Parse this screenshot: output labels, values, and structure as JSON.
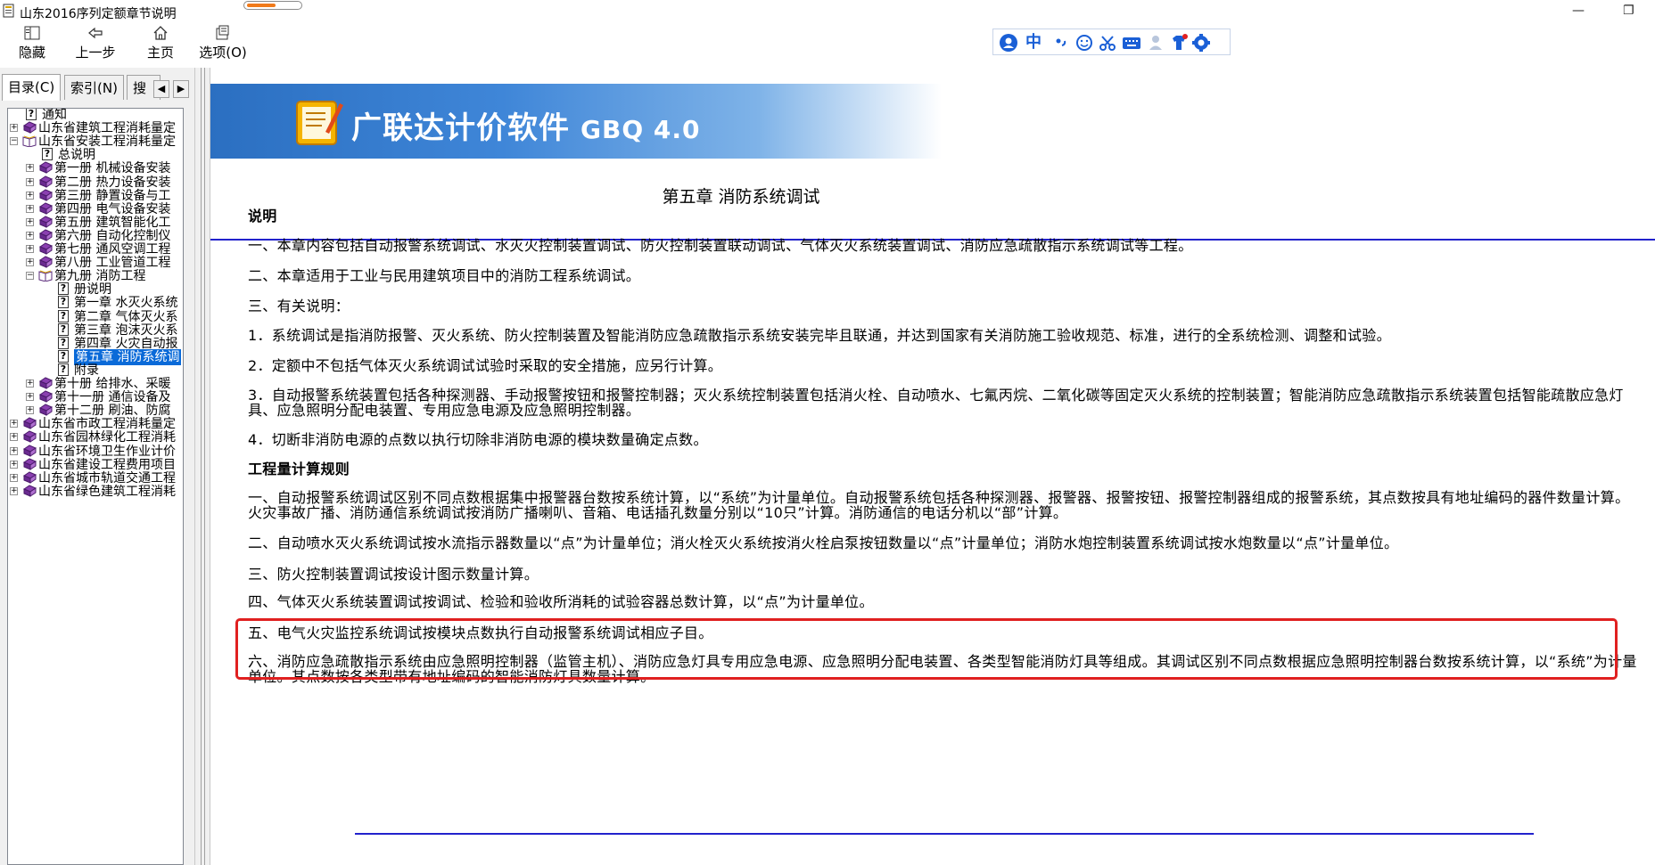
{
  "window": {
    "title": "山东2016序列定额章节说明",
    "progress_fraction": 0.55
  },
  "toolbar": {
    "hide_label": "隐藏",
    "back_label": "上一步",
    "home_label": "主页",
    "options_label": "选项(O)"
  },
  "ime": {
    "mode_label": "中",
    "icons": [
      "user-icon",
      "chinese-mode",
      "punctuation-icon",
      "emoji-icon",
      "scissors-icon",
      "keyboard-icon",
      "person-icon",
      "shirt-icon",
      "settings-icon"
    ],
    "accent_color": "#1a5fd6"
  },
  "left_tabs": {
    "contents": "目录(C)",
    "index": "索引(N)",
    "search": "搜"
  },
  "tree": [
    {
      "label": "通知",
      "icon": "help-page",
      "level": 1,
      "exp": ""
    },
    {
      "label": "山东省建筑工程消耗量定",
      "icon": "book-closed",
      "level": 0,
      "exp": "+"
    },
    {
      "label": "山东省安装工程消耗量定",
      "icon": "book-open",
      "level": 0,
      "exp": "-"
    },
    {
      "label": "总说明",
      "icon": "help-page",
      "level": 2,
      "exp": ""
    },
    {
      "label": "第一册  机械设备安装",
      "icon": "book-closed",
      "level": 1,
      "exp": "+"
    },
    {
      "label": "第二册  热力设备安装",
      "icon": "book-closed",
      "level": 1,
      "exp": "+"
    },
    {
      "label": "第三册  静置设备与工",
      "icon": "book-closed",
      "level": 1,
      "exp": "+"
    },
    {
      "label": "第四册  电气设备安装",
      "icon": "book-closed",
      "level": 1,
      "exp": "+"
    },
    {
      "label": "第五册  建筑智能化工",
      "icon": "book-closed",
      "level": 1,
      "exp": "+"
    },
    {
      "label": "第六册  自动化控制仪",
      "icon": "book-closed",
      "level": 1,
      "exp": "+"
    },
    {
      "label": "第七册  通风空调工程",
      "icon": "book-closed",
      "level": 1,
      "exp": "+"
    },
    {
      "label": "第八册  工业管道工程",
      "icon": "book-closed",
      "level": 1,
      "exp": "+"
    },
    {
      "label": "第九册  消防工程",
      "icon": "book-open",
      "level": 1,
      "exp": "-"
    },
    {
      "label": "册说明",
      "icon": "help-page",
      "level": 3,
      "exp": ""
    },
    {
      "label": "第一章  水灭火系统",
      "icon": "help-page",
      "level": 3,
      "exp": ""
    },
    {
      "label": "第二章  气体灭火系",
      "icon": "help-page",
      "level": 3,
      "exp": ""
    },
    {
      "label": "第三章  泡沫灭火系",
      "icon": "help-page",
      "level": 3,
      "exp": ""
    },
    {
      "label": "第四章  火灾自动报",
      "icon": "help-page",
      "level": 3,
      "exp": ""
    },
    {
      "label": "第五章  消防系统调",
      "icon": "help-page",
      "level": 3,
      "exp": "",
      "selected": true
    },
    {
      "label": "附录",
      "icon": "help-page",
      "level": 3,
      "exp": ""
    },
    {
      "label": "第十册  给排水、采暖",
      "icon": "book-closed",
      "level": 1,
      "exp": "+"
    },
    {
      "label": "第十一册  通信设备及",
      "icon": "book-closed",
      "level": 1,
      "exp": "+"
    },
    {
      "label": "第十二册  刷油、防腐",
      "icon": "book-closed",
      "level": 1,
      "exp": "+"
    },
    {
      "label": "山东省市政工程消耗量定",
      "icon": "book-closed",
      "level": 0,
      "exp": "+"
    },
    {
      "label": "山东省园林绿化工程消耗",
      "icon": "book-closed",
      "level": 0,
      "exp": "+"
    },
    {
      "label": "山东省环境卫生作业计价",
      "icon": "book-closed",
      "level": 0,
      "exp": "+"
    },
    {
      "label": "山东省建设工程费用项目",
      "icon": "book-closed",
      "level": 0,
      "exp": "+"
    },
    {
      "label": "山东省城市轨道交通工程",
      "icon": "book-closed",
      "level": 0,
      "exp": "+"
    },
    {
      "label": "山东省绿色建筑工程消耗",
      "icon": "book-closed",
      "level": 0,
      "exp": "+"
    }
  ],
  "banner": {
    "brand": "广联达计价软件",
    "version": "GBQ 4.0"
  },
  "content": {
    "chapter_title": "第五章  消防系统调试",
    "paragraphs": [
      {
        "text": "说明",
        "heading": true
      },
      {
        "text": "一、本章内容包括自动报警系统调试、水灭火控制装置调试、防火控制装置联动调试、气体灭火系统装置调试、消防应急疏散指示系统调试等工程。"
      },
      {
        "text": "二、本章适用于工业与民用建筑项目中的消防工程系统调试。"
      },
      {
        "text": "三、有关说明："
      },
      {
        "text": "1．系统调试是指消防报警、灭火系统、防火控制装置及智能消防应急疏散指示系统安装完毕且联通，并达到国家有关消防施工验收规范、标准，进行的全系统检测、调整和试验。"
      },
      {
        "text": "2．定额中不包括气体灭火系统调试试验时采取的安全措施，应另行计算。"
      },
      {
        "text": "3．自动报警系统装置包括各种探测器、手动报警按钮和报警控制器；灭火系统控制装置包括消火栓、自动喷水、七氟丙烷、二氧化碳等固定灭火系统的控制装置；智能消防应急疏散指示系统装置包括智能疏散应急灯具、应急照明分配电装置、专用应急电源及应急照明控制器。"
      },
      {
        "text": "4．切断非消防电源的点数以执行切除非消防电源的模块数量确定点数。"
      },
      {
        "text": "工程量计算规则",
        "heading": true
      },
      {
        "text": "一、自动报警系统调试区别不同点数根据集中报警器台数按系统计算，以“系统”为计量单位。自动报警系统包括各种探测器、报警器、报警按钮、报警控制器组成的报警系统，其点数按具有地址编码的器件数量计算。火灾事故广播、消防通信系统调试按消防广播喇叭、音箱、电话插孔数量分别以“10只”计算。消防通信的电话分机以“部”计算。"
      },
      {
        "text": "二、自动喷水灭火系统调试按水流指示器数量以“点”为计量单位；消火栓灭火系统按消火栓启泵按钮数量以“点”计量单位；消防水炮控制装置系统调试按水炮数量以“点”计量单位。"
      },
      {
        "text": "三、防火控制装置调试按设计图示数量计算。"
      },
      {
        "text": "四、气体灭火系统装置调试按调试、检验和验收所消耗的试验容器总数计算，以“点”为计量单位。"
      },
      {
        "text": "五、电气火灾监控系统调试按模块点数执行自动报警系统调试相应子目。"
      },
      {
        "text": "六、消防应急疏散指示系统由应急照明控制器（监管主机）、消防应急灯具专用应急电源、应急照明分配电装置、各类型智能消防灯具等组成。其调试区别不同点数根据应急照明控制器台数按系统计算，以“系统”为计量单位。其点数按各类型带有地址编码的智能消防灯具数量计算。"
      }
    ],
    "highlight_color": "#e02020",
    "rule_color": "#2222cc"
  }
}
